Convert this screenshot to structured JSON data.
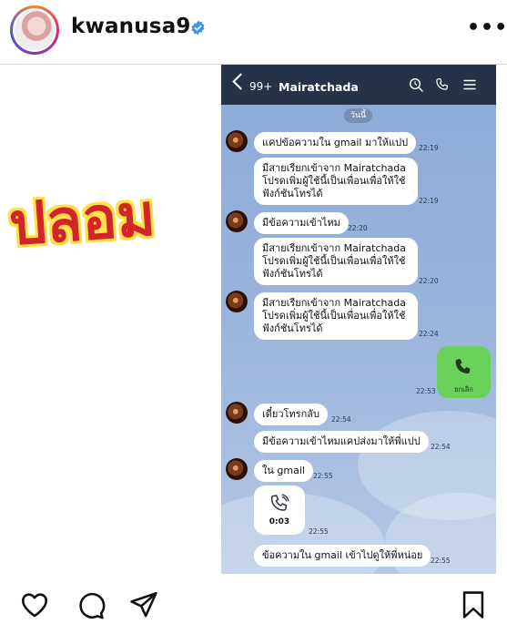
{
  "post": {
    "username": "kwanusa9",
    "verified": true,
    "more_label": "•••"
  },
  "stamp_text": "ปลอม",
  "line_chat": {
    "back_count": "99+",
    "chat_name": "Mairatchada",
    "date_chip": "วันนี้",
    "top_icons": [
      "search-icon",
      "phone-icon",
      "menu-icon"
    ],
    "messages": [
      {
        "from": "friend",
        "text": "แคปข้อความใน gmail มาให้แปป",
        "time": "22:19"
      },
      {
        "from": "friend",
        "text": "มีสายเรียกเข้าจาก Mairatchada โปรดเพิ่มผู้ใช้นี้เป็นเพื่อนเพื่อให้ใช้ฟังก์ชันโทรได้",
        "time": "22:19"
      },
      {
        "from": "friend",
        "text": "มีข้อความเข้าไหม",
        "time": "22:20"
      },
      {
        "from": "friend",
        "text": "มีสายเรียกเข้าจาก Mairatchada โปรดเพิ่มผู้ใช้นี้เป็นเพื่อนเพื่อให้ใช้ฟังก์ชันโทรได้",
        "time": "22:20"
      },
      {
        "from": "friend",
        "text": "มีสายเรียกเข้าจาก Mairatchada โปรดเพิ่มผู้ใช้นี้เป็นเพื่อนเพื่อให้ใช้ฟังก์ชันโทรได้",
        "time": "22:24"
      },
      {
        "from": "me",
        "type": "call",
        "label": "ยกเลิก",
        "time": "22:53"
      },
      {
        "from": "friend",
        "text": "เดี๋ยวโทรกลับ",
        "time": "22:54"
      },
      {
        "from": "friend",
        "text": "มีข้อความเข้าไหมแคปส่งมาให้พี่แปป",
        "time": "22:54"
      },
      {
        "from": "friend",
        "text": "ใน gmail",
        "time": "22:55"
      },
      {
        "from": "friend",
        "type": "voice",
        "duration": "0:03",
        "time": "22:55"
      },
      {
        "from": "friend",
        "text": "ข้อความใน gmail เข้าไปดูให้พี่หน่อย",
        "time": "22:55"
      }
    ]
  },
  "actions": [
    "heart-icon",
    "comment-icon",
    "share-icon",
    "bookmark-icon"
  ],
  "colors": {
    "line_header": "#263248",
    "line_bg": "#9cb6dd",
    "my_bubble": "#6ad25a",
    "verified": "#3897f0",
    "stamp_red": "#d4242a",
    "stamp_outline": "#ffe14a"
  }
}
